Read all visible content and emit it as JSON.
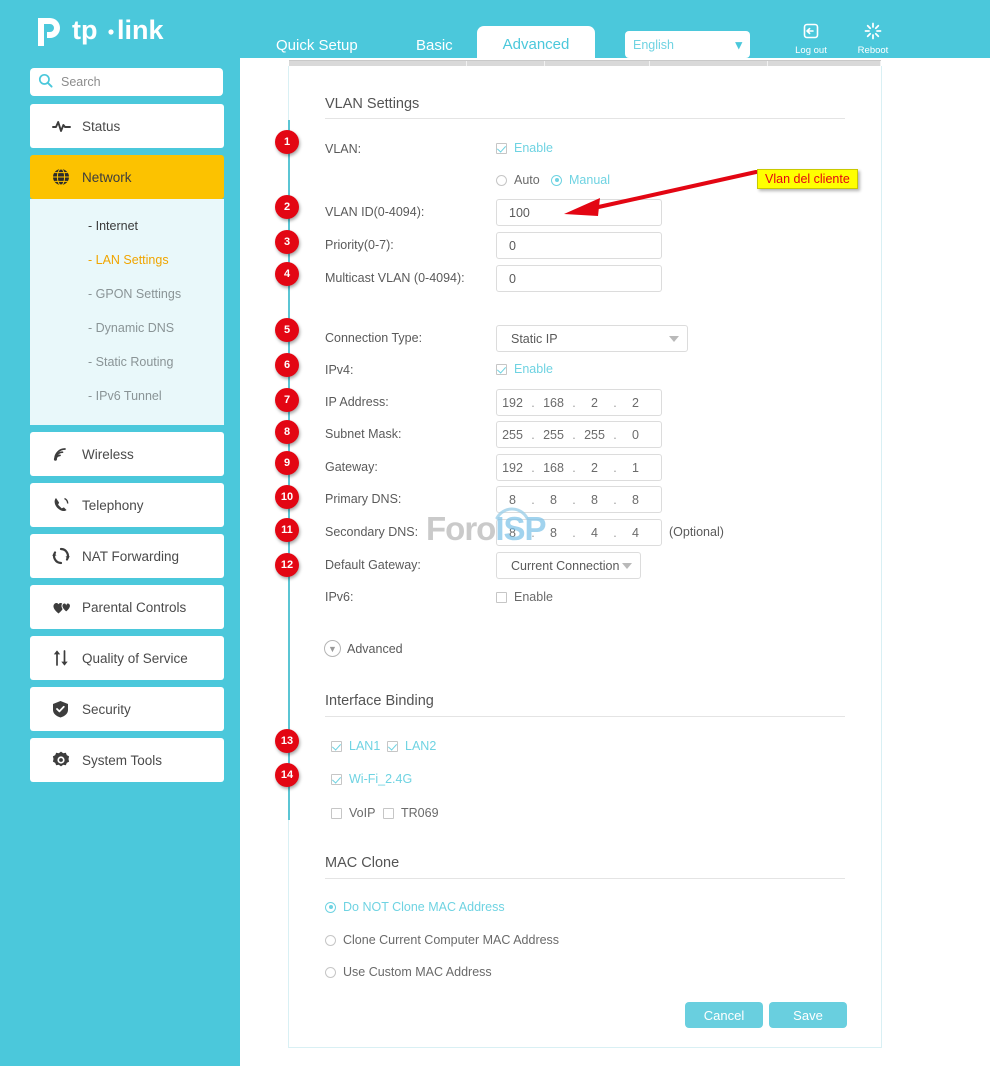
{
  "brand": {
    "name": "tp-link"
  },
  "header": {
    "tabs": [
      {
        "id": "quick-setup",
        "label": "Quick Setup",
        "active": false
      },
      {
        "id": "basic",
        "label": "Basic",
        "active": false
      },
      {
        "id": "advanced",
        "label": "Advanced",
        "active": true
      }
    ],
    "language": {
      "value": "English",
      "caret": "⌄"
    },
    "logout": {
      "label": "Log out",
      "icon": "logout-icon"
    },
    "reboot": {
      "label": "Reboot",
      "icon": "reboot-icon"
    }
  },
  "search": {
    "placeholder": "Search",
    "value": "",
    "icon": "search-icon"
  },
  "sidebar": {
    "items": [
      {
        "label": "Status",
        "icon": "pulse-icon",
        "selected": false
      },
      {
        "label": "Network",
        "icon": "globe-icon",
        "selected": true
      },
      {
        "label": "Wireless",
        "icon": "wifi-icon",
        "selected": false
      },
      {
        "label": "Telephony",
        "icon": "phone-icon",
        "selected": false
      },
      {
        "label": "NAT Forwarding",
        "icon": "refresh-icon",
        "selected": false
      },
      {
        "label": "Parental Controls",
        "icon": "hearts-icon",
        "selected": false
      },
      {
        "label": "Quality of Service",
        "icon": "arrows-icon",
        "selected": false
      },
      {
        "label": "Security",
        "icon": "shield-icon",
        "selected": false
      },
      {
        "label": "System Tools",
        "icon": "gear-icon",
        "selected": false
      }
    ],
    "submenu": [
      {
        "label": "- Internet",
        "state": "dark"
      },
      {
        "label": "- LAN Settings",
        "state": "active"
      },
      {
        "label": "- GPON Settings",
        "state": "muted"
      },
      {
        "label": "- Dynamic DNS",
        "state": "muted"
      },
      {
        "label": "- Static Routing",
        "state": "muted"
      },
      {
        "label": "- IPv6 Tunnel",
        "state": "muted"
      }
    ]
  },
  "vlan_section": {
    "title": "VLAN Settings",
    "vlan_label": "VLAN:",
    "vlan_enable_label": "Enable",
    "vlan_enable_checked": true,
    "mode_auto_label": "Auto",
    "mode_manual_label": "Manual",
    "mode_selected": "Manual",
    "vlan_id_label": "VLAN ID(0-4094):",
    "vlan_id_value": "100",
    "priority_label": "Priority(0-7):",
    "priority_value": "0",
    "multicast_label": "Multicast VLAN (0-4094):",
    "multicast_value": "0"
  },
  "connection_section": {
    "conn_type_label": "Connection Type:",
    "conn_type_value": "Static IP",
    "ipv4_label": "IPv4:",
    "ipv4_enable_label": "Enable",
    "ipv4_enable_checked": true,
    "ip_address_label": "IP Address:",
    "ip_address_octets": [
      "192",
      "168",
      "2",
      "2"
    ],
    "subnet_label": "Subnet Mask:",
    "subnet_octets": [
      "255",
      "255",
      "255",
      "0"
    ],
    "gateway_label": "Gateway:",
    "gateway_octets": [
      "192",
      "168",
      "2",
      "1"
    ],
    "primary_dns_label": "Primary DNS:",
    "primary_dns_octets": [
      "8",
      "8",
      "8",
      "8"
    ],
    "secondary_dns_label": "Secondary DNS:",
    "secondary_dns_octets": [
      "8",
      "8",
      "4",
      "4"
    ],
    "secondary_dns_note": "(Optional)",
    "default_gateway_label": "Default Gateway:",
    "default_gateway_value": "Current Connection",
    "ipv6_label": "IPv6:",
    "ipv6_enable_label": "Enable",
    "ipv6_enable_checked": false,
    "advanced_toggle_label": "Advanced"
  },
  "interface_binding": {
    "title": "Interface Binding",
    "options": [
      {
        "label": "LAN1",
        "checked": true
      },
      {
        "label": "LAN2",
        "checked": true
      },
      {
        "label": "Wi-Fi_2.4G",
        "checked": true
      },
      {
        "label": "VoIP",
        "checked": false
      },
      {
        "label": "TR069",
        "checked": false
      }
    ]
  },
  "mac_clone": {
    "title": "MAC Clone",
    "options": [
      {
        "label": "Do NOT Clone MAC Address",
        "selected": true
      },
      {
        "label": "Clone Current Computer MAC Address",
        "selected": false
      },
      {
        "label": "Use Custom MAC Address",
        "selected": false
      }
    ]
  },
  "buttons": {
    "cancel": "Cancel",
    "save": "Save"
  },
  "annotations": {
    "callout_text": "Vlan del cliente",
    "callout_bg": "#ffff00",
    "callout_color": "#e30613",
    "badge_color": "#e30613",
    "badges": [
      "1",
      "2",
      "3",
      "4",
      "5",
      "6",
      "7",
      "8",
      "9",
      "10",
      "11",
      "12",
      "13",
      "14"
    ]
  },
  "watermark": {
    "part1": "Foro",
    "part2": "ISP"
  },
  "colors": {
    "teal": "#4bc8db",
    "accent_yellow": "#fcc200",
    "link_teal": "#6fd3e2"
  }
}
